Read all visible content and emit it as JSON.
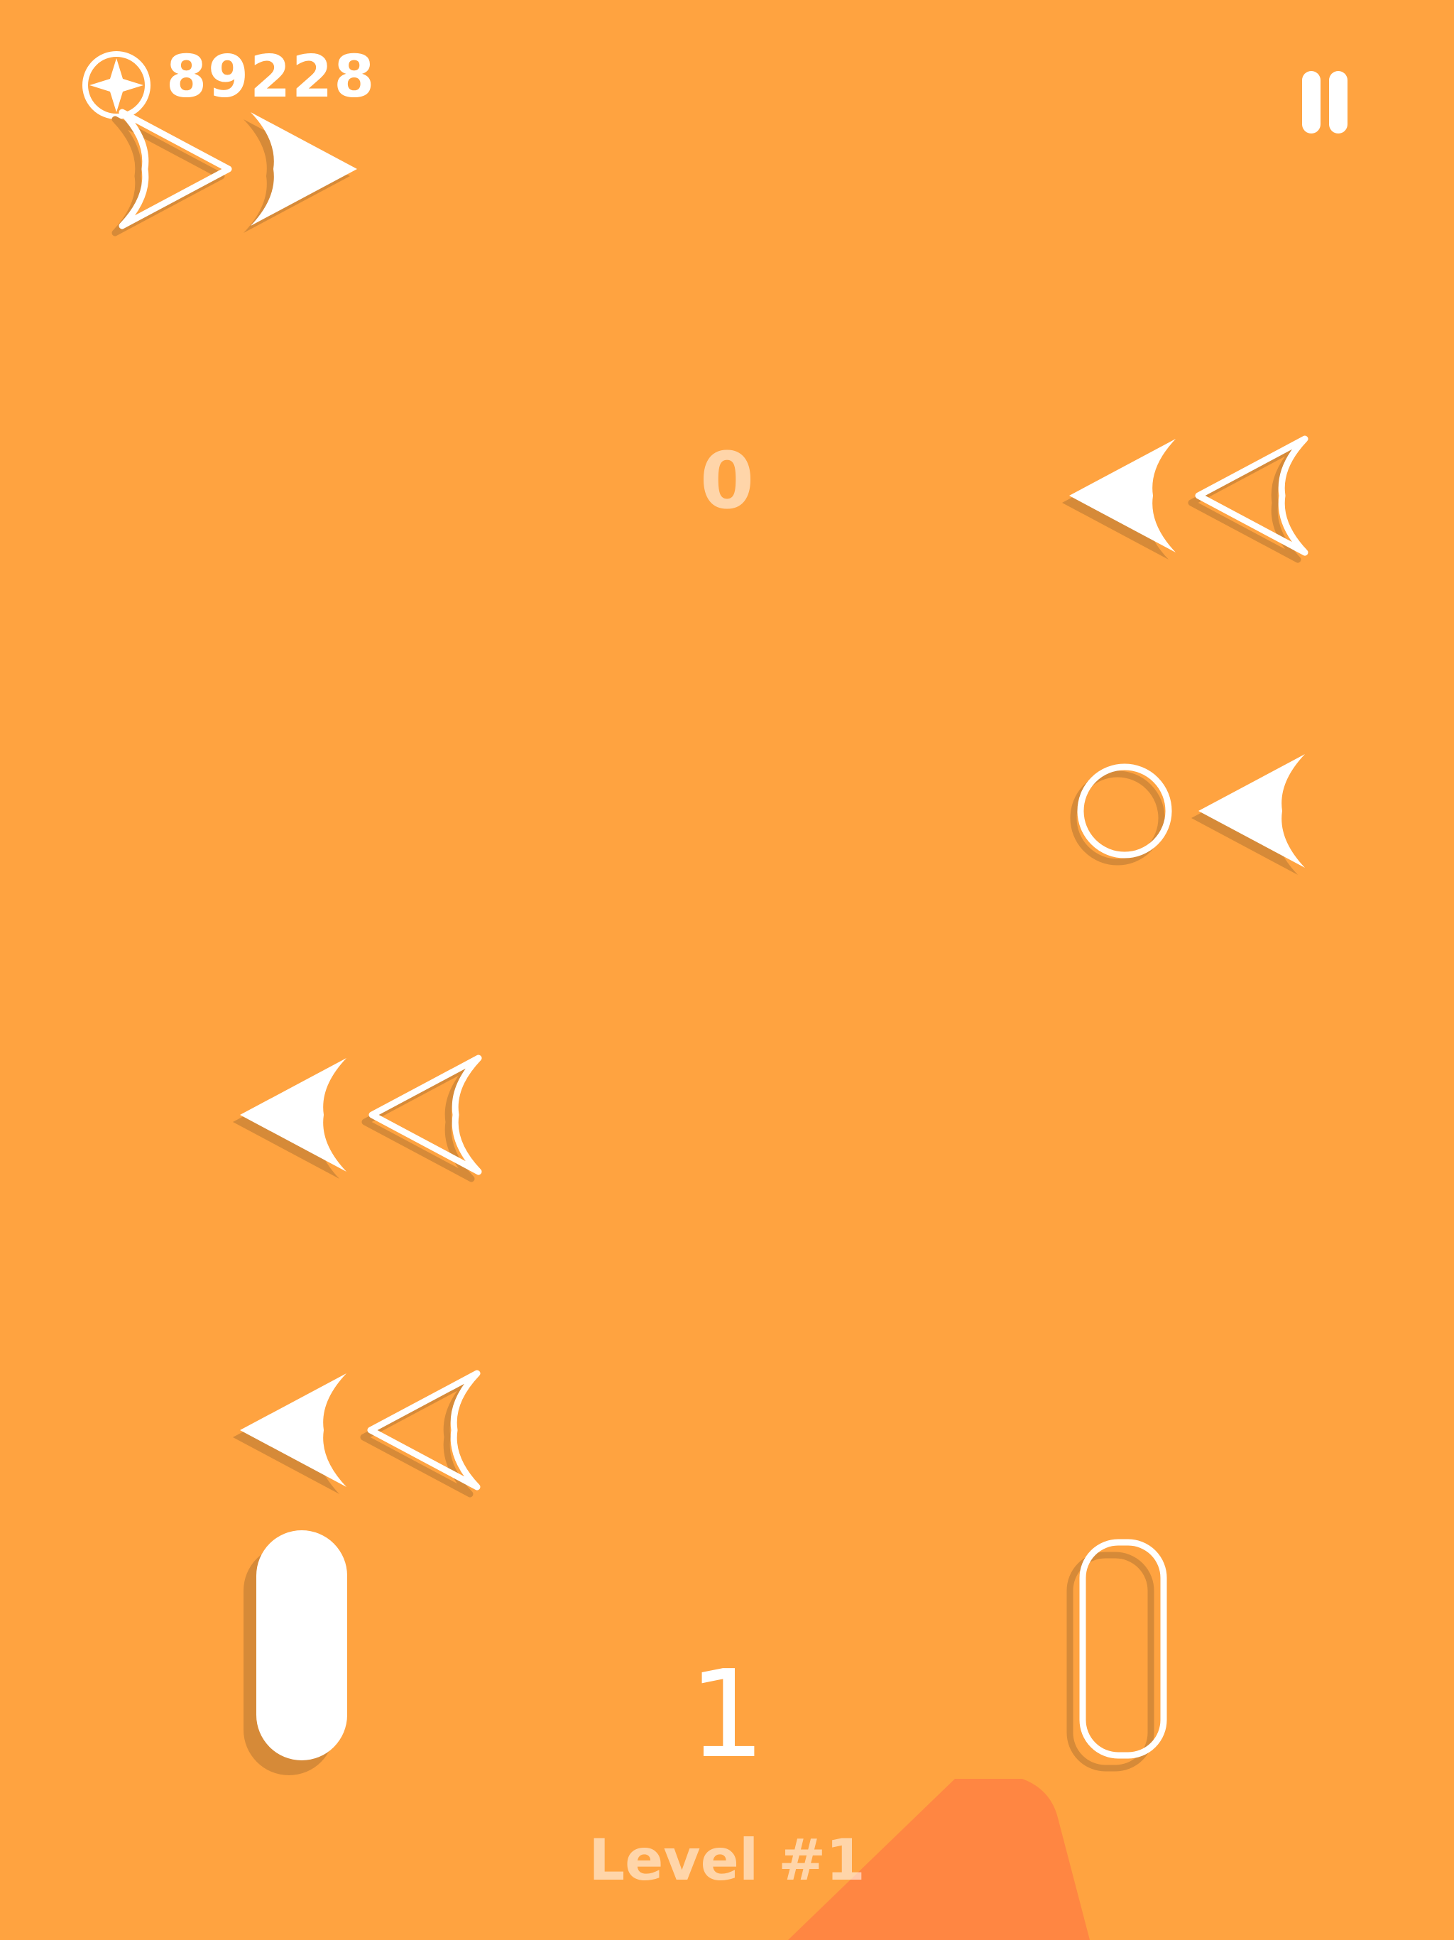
{
  "hud": {
    "coins": "89228",
    "coin_icon": "star-coin-icon",
    "pause_icon": "pause-icon"
  },
  "board": {
    "score": "0",
    "moves": "1",
    "level_label": "Level #1"
  },
  "colors": {
    "background": "#ffa340",
    "piece": "#ffffff",
    "shadow": "#d68a38",
    "accent": "#ff8642"
  },
  "pieces": [
    {
      "name": "arrow-right-outline-piece",
      "kind": "arrow-right-outline"
    },
    {
      "name": "arrow-right-filled-piece",
      "kind": "arrow-right-filled"
    },
    {
      "name": "arrow-left-filled-piece-row1",
      "kind": "arrow-left-filled"
    },
    {
      "name": "arrow-left-outline-piece-row1",
      "kind": "arrow-left-outline"
    },
    {
      "name": "ring-piece",
      "kind": "circle-outline"
    },
    {
      "name": "arrow-left-filled-piece-row2",
      "kind": "arrow-left-filled"
    },
    {
      "name": "arrow-left-filled-piece-row3",
      "kind": "arrow-left-filled"
    },
    {
      "name": "arrow-left-outline-piece-row3",
      "kind": "arrow-left-outline"
    },
    {
      "name": "arrow-left-filled-piece-row4",
      "kind": "arrow-left-filled"
    },
    {
      "name": "arrow-left-outline-piece-row4",
      "kind": "arrow-left-outline"
    },
    {
      "name": "filled-paddle-piece",
      "kind": "paddle-filled"
    },
    {
      "name": "outline-paddle-piece",
      "kind": "paddle-outline"
    }
  ]
}
